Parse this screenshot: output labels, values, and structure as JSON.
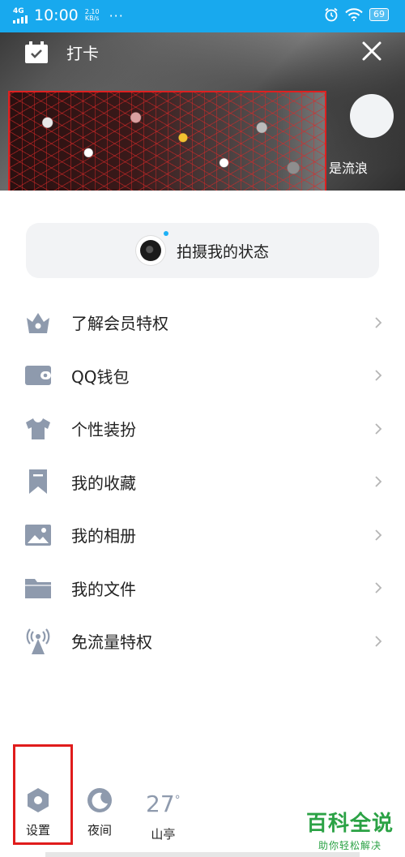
{
  "status_bar": {
    "network": "4G",
    "time": "10:00",
    "speed_value": "2.10",
    "speed_unit": "KB/s",
    "more": "···",
    "battery": "69"
  },
  "header": {
    "checkin_label": "打卡",
    "signature_snippet": "是流浪"
  },
  "status_capture": {
    "label": "拍摄我的状态"
  },
  "menu": {
    "items": [
      {
        "label": "了解会员特权",
        "icon": "vip-crown-icon"
      },
      {
        "label": "QQ钱包",
        "icon": "wallet-icon"
      },
      {
        "label": "个性装扮",
        "icon": "tshirt-icon"
      },
      {
        "label": "我的收藏",
        "icon": "bookmark-icon"
      },
      {
        "label": "我的相册",
        "icon": "photo-icon"
      },
      {
        "label": "我的文件",
        "icon": "folder-icon"
      },
      {
        "label": "免流量特权",
        "icon": "broadcast-tower-icon"
      }
    ]
  },
  "bottom": {
    "settings_label": "设置",
    "night_label": "夜间",
    "temperature": "27",
    "temperature_unit": "°",
    "location": "山亭"
  },
  "watermark": {
    "title": "百科全说",
    "subtitle": "助你轻松解决"
  },
  "colors": {
    "status_bar": "#18a9ee",
    "icon_gray": "#8e9aad",
    "highlight_red": "#e01c1c",
    "watermark_green": "#2ba245"
  }
}
